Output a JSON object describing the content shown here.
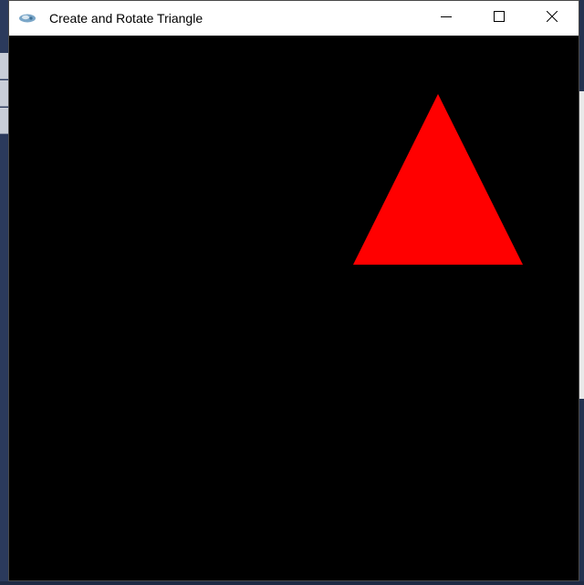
{
  "window": {
    "title": "Create and Rotate Triangle",
    "controls": [
      "minimize",
      "maximize",
      "close"
    ]
  },
  "canvas": {
    "background": "#000000",
    "shape": {
      "type": "triangle",
      "fill": "#ff0000"
    }
  },
  "icons": {
    "app": "app-icon",
    "minimize": "minimize-icon",
    "maximize": "maximize-icon",
    "close": "close-icon"
  }
}
